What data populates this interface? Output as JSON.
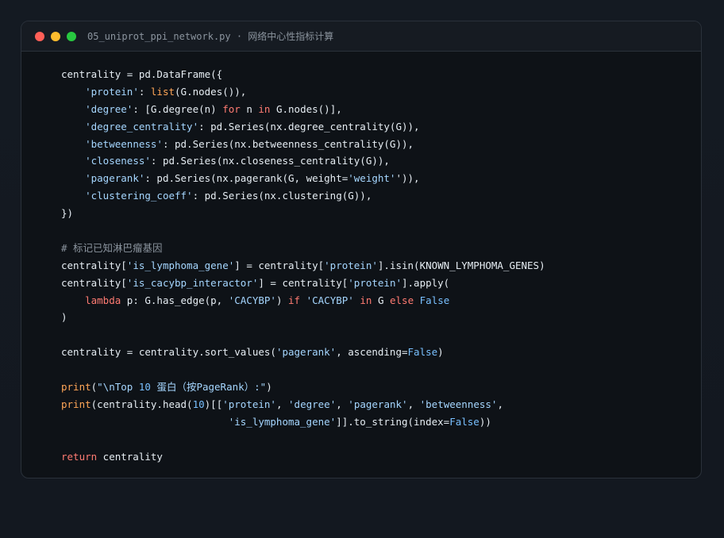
{
  "window": {
    "title": "05_uniprot_ppi_network.py · 网络中心性指标计算",
    "controls": [
      {
        "name": "close",
        "color": "#ff5f57"
      },
      {
        "name": "minimize",
        "color": "#febc2e"
      },
      {
        "name": "maximize",
        "color": "#28c840"
      }
    ]
  },
  "colors": {
    "background": "#131820",
    "window_bg": "#0e1217",
    "titlebar_bg": "#161b22",
    "string": "#a5d6ff",
    "keyword": "#ff7b72",
    "builtin": "#ffa657",
    "number": "#79c0ff",
    "constant": "#79c0ff",
    "comment": "#8b949e",
    "plain": "#e6edf3"
  },
  "code": {
    "language": "python",
    "lines": [
      [
        [
          "pl",
          "centrality = pd.DataFrame({"
        ]
      ],
      [
        [
          "pl",
          "    "
        ],
        [
          "str",
          "'protein'"
        ],
        [
          "pl",
          ": "
        ],
        [
          "fn",
          "list"
        ],
        [
          "pl",
          "(G.nodes()),"
        ]
      ],
      [
        [
          "pl",
          "    "
        ],
        [
          "str",
          "'degree'"
        ],
        [
          "pl",
          ": [G.degree(n) "
        ],
        [
          "kw",
          "for"
        ],
        [
          "pl",
          " n "
        ],
        [
          "kw",
          "in"
        ],
        [
          "pl",
          " G.nodes()],"
        ]
      ],
      [
        [
          "pl",
          "    "
        ],
        [
          "str",
          "'degree_centrality'"
        ],
        [
          "pl",
          ": pd.Series(nx.degree_centrality(G)),"
        ]
      ],
      [
        [
          "pl",
          "    "
        ],
        [
          "str",
          "'betweenness'"
        ],
        [
          "pl",
          ": pd.Series(nx.betweenness_centrality(G)),"
        ]
      ],
      [
        [
          "pl",
          "    "
        ],
        [
          "str",
          "'closeness'"
        ],
        [
          "pl",
          ": pd.Series(nx.closeness_centrality(G)),"
        ]
      ],
      [
        [
          "pl",
          "    "
        ],
        [
          "str",
          "'pagerank'"
        ],
        [
          "pl",
          ": pd.Series(nx.pagerank(G, weight="
        ],
        [
          "str",
          "'weight'"
        ],
        [
          "pl",
          "')),"
        ]
      ],
      [
        [
          "pl",
          "    "
        ],
        [
          "str",
          "'clustering_coeff'"
        ],
        [
          "pl",
          ": pd.Series(nx.clustering(G)),"
        ]
      ],
      [
        [
          "pl",
          "})"
        ]
      ],
      [],
      [
        [
          "cmt",
          "# 标记已知淋巴瘤基因"
        ]
      ],
      [
        [
          "pl",
          "centrality["
        ],
        [
          "str",
          "'is_lymphoma_gene'"
        ],
        [
          "pl",
          "] = centrality["
        ],
        [
          "str",
          "'protein'"
        ],
        [
          "pl",
          "].isin(KNOWN_LYMPHOMA_GENES)"
        ]
      ],
      [
        [
          "pl",
          "centrality["
        ],
        [
          "str",
          "'is_cacybp_interactor'"
        ],
        [
          "pl",
          "] = centrality["
        ],
        [
          "str",
          "'protein'"
        ],
        [
          "pl",
          "].apply("
        ]
      ],
      [
        [
          "pl",
          "    "
        ],
        [
          "kw",
          "lambda"
        ],
        [
          "pl",
          " p: G.has_edge(p, "
        ],
        [
          "str",
          "'CACYBP'"
        ],
        [
          "pl",
          ") "
        ],
        [
          "kw",
          "if"
        ],
        [
          "pl",
          " "
        ],
        [
          "str",
          "'CACYBP'"
        ],
        [
          "pl",
          " "
        ],
        [
          "kw",
          "in"
        ],
        [
          "pl",
          " G "
        ],
        [
          "kw",
          "else"
        ],
        [
          "pl",
          " "
        ],
        [
          "const",
          "False"
        ]
      ],
      [
        [
          "pl",
          ")"
        ]
      ],
      [],
      [
        [
          "pl",
          "centrality = centrality.sort_values("
        ],
        [
          "str",
          "'pagerank'"
        ],
        [
          "pl",
          ", ascending="
        ],
        [
          "const",
          "False"
        ],
        [
          "pl",
          ")"
        ]
      ],
      [],
      [
        [
          "fn",
          "print"
        ],
        [
          "pl",
          "("
        ],
        [
          "str",
          "\"\\nTop "
        ],
        [
          "num",
          "10"
        ],
        [
          "str",
          " 蛋白（按PageRank）:\""
        ],
        [
          "pl",
          ")"
        ]
      ],
      [
        [
          "fn",
          "print"
        ],
        [
          "pl",
          "(centrality.head("
        ],
        [
          "num",
          "10"
        ],
        [
          "pl",
          ")[["
        ],
        [
          "str",
          "'protein'"
        ],
        [
          "pl",
          ", "
        ],
        [
          "str",
          "'degree'"
        ],
        [
          "pl",
          ", "
        ],
        [
          "str",
          "'pagerank'"
        ],
        [
          "pl",
          ", "
        ],
        [
          "str",
          "'betweenness'"
        ],
        [
          "pl",
          ","
        ]
      ],
      [
        [
          "pl",
          "                            "
        ],
        [
          "str",
          "'is_lymphoma_gene'"
        ],
        [
          "pl",
          "]].to_string(index="
        ],
        [
          "const",
          "False"
        ],
        [
          "pl",
          "))"
        ]
      ],
      [],
      [
        [
          "kw",
          "return"
        ],
        [
          "pl",
          " centrality"
        ]
      ]
    ]
  }
}
